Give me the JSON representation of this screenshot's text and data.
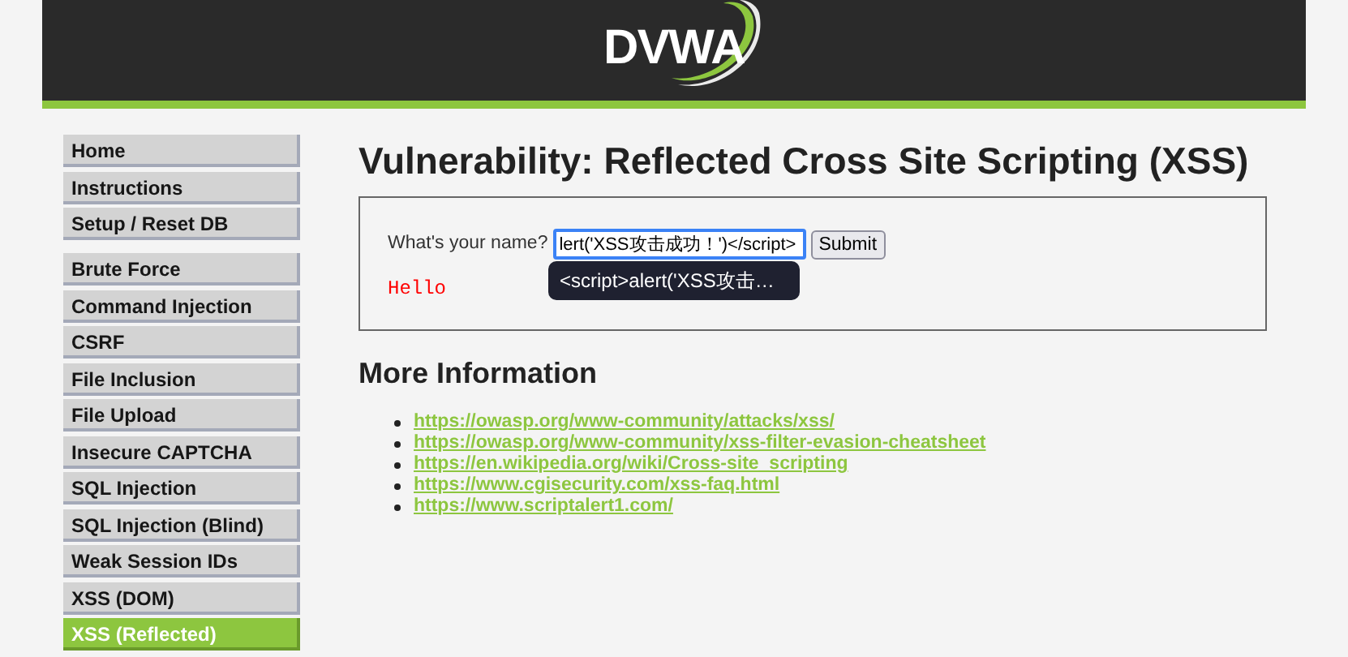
{
  "header": {
    "logo": "DVWA"
  },
  "sidebar": {
    "groups": [
      [
        {
          "label": "Home",
          "selected": false
        },
        {
          "label": "Instructions",
          "selected": false
        },
        {
          "label": "Setup / Reset DB",
          "selected": false
        }
      ],
      [
        {
          "label": "Brute Force",
          "selected": false
        },
        {
          "label": "Command Injection",
          "selected": false
        },
        {
          "label": "CSRF",
          "selected": false
        },
        {
          "label": "File Inclusion",
          "selected": false
        },
        {
          "label": "File Upload",
          "selected": false
        },
        {
          "label": "Insecure CAPTCHA",
          "selected": false
        },
        {
          "label": "SQL Injection",
          "selected": false
        },
        {
          "label": "SQL Injection (Blind)",
          "selected": false
        },
        {
          "label": "Weak Session IDs",
          "selected": false
        },
        {
          "label": "XSS (DOM)",
          "selected": false
        },
        {
          "label": "XSS (Reflected)",
          "selected": true
        }
      ]
    ]
  },
  "title": "Vulnerability: Reflected Cross Site Scripting (XSS)",
  "form": {
    "label": "What's your name?",
    "value": "lert('XSS攻击成功！')</script>",
    "button": "Submit",
    "autocomplete": "<script>alert('XSS攻击…",
    "output": "Hello"
  },
  "more_info": {
    "heading": "More Information",
    "links": [
      "https://owasp.org/www-community/attacks/xss/",
      "https://owasp.org/www-community/xss-filter-evasion-cheatsheet",
      "https://en.wikipedia.org/wiki/Cross-site_scripting",
      "https://www.cgisecurity.com/xss-faq.html",
      "https://www.scriptalert1.com/"
    ]
  }
}
